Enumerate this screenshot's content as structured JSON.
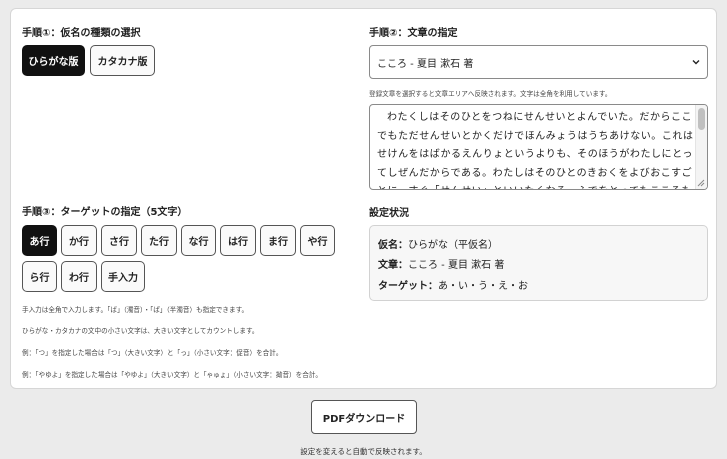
{
  "step1": {
    "title": "手順①：仮名の種類の選択",
    "hiragana_label": "ひらがな版",
    "katakana_label": "カタカナ版"
  },
  "step2": {
    "title": "手順②：文章の指定",
    "selected_text": "こころ - 夏目 漱石 著",
    "note": "登録文章を選択すると文章エリアへ反映されます。文字は全角を利用しています。",
    "body": "わたくしはそのひとをつねにせんせいとよんでいた。だからここでもただせんせいとかくだけでほんみょうはうちあけない。これはせけんをはばかるえんりょというよりも、そのほうがわたしにとってしぜんだからである。わたしはそのひとのきおくをよびおこすごとに、すぐ「せんせい」といいたくなる。ふでをとってもこころもちはおなじことである。"
  },
  "step3": {
    "title": "手順③：ターゲットの指定（5文字）",
    "buttons": {
      "a": "あ行",
      "ka": "か行",
      "sa": "さ行",
      "ta": "た行",
      "na": "な行",
      "ha": "は行",
      "ma": "ま行",
      "ya": "や行",
      "ra": "ら行",
      "wa": "わ行",
      "manual": "手入力"
    },
    "notes": [
      "手入力は全角で入力します。「ば」（濁音）・「ぱ」（半濁音）も指定できます。",
      "ひらがな・カタカナの文中の小さい文字は、大きい文字としてカウントします。",
      "例：「つ」を指定した場合は「つ」（大きい文字）と「っ」（小さい文字：促音）を合計。",
      "例：「やゆよ」を指定した場合は「やゆよ」（大きい文字）と「ゃゅょ」（小さい文字：拗音）を合計。"
    ]
  },
  "status": {
    "title": "設定状況",
    "kana_key": "仮名：",
    "kana_value": "ひらがな（平仮名）",
    "text_key": "文章：",
    "text_value": "こころ - 夏目 漱石 著",
    "target_key": "ターゲット：",
    "target_value": "あ・い・う・え・お"
  },
  "pdf_label": "PDFダウンロード",
  "footer_note": "設定を変えると自動で反映されます。",
  "icons": {
    "select": "chevron-down-icon",
    "resize": "resize-handle-icon"
  },
  "colors": {
    "active": "#111111",
    "panel": "#ffffff",
    "page": "#ebebeb"
  }
}
